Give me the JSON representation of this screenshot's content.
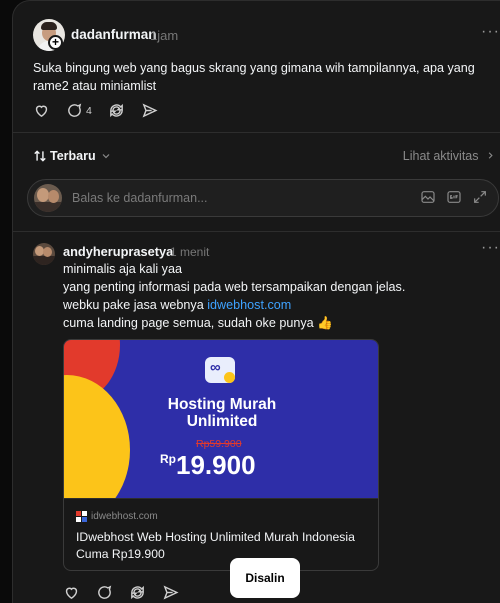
{
  "original_post": {
    "username": "dadanfurman",
    "time": "1jam",
    "more_label": "···",
    "plus_label": "+",
    "text": "Suka bingung web yang bagus skrang yang gimana wih tampilannya, apa yang rame2 atau miniamlist",
    "reply_count": "4"
  },
  "sort": {
    "label": "Terbaru",
    "activity_label": "Lihat aktivitas"
  },
  "reply_box": {
    "placeholder": "Balas ke dadanfurman..."
  },
  "reply": {
    "username": "andyheruprasetya",
    "time": "1 menit",
    "more_label": "···",
    "lines": [
      "minimalis aja kali yaa",
      "yang penting informasi pada web tersampaikan dengan jelas.",
      "webku pake jasa webnya ",
      "cuma landing page semua, sudah oke punya 👍"
    ],
    "link_text": "idwebhost.com"
  },
  "link_card": {
    "banner_title_1": "Hosting Murah",
    "banner_title_2": "Unlimited",
    "logo_glyph": "∞",
    "old_price": "Rp59.900",
    "currency": "Rp",
    "price": "19.900",
    "domain": "idwebhost.com",
    "title": "IDwebhost Web Hosting Unlimited Murah Indonesia Cuma Rp19.900",
    "colors": {
      "banner": "#2e2ea8",
      "red": "#e23a2c",
      "yellow": "#fcc419"
    }
  },
  "toast": {
    "label": "Disalin"
  },
  "icons": [
    "heart-icon",
    "comment-icon",
    "repost-icon",
    "share-icon",
    "sort-icon",
    "chevron-down-icon",
    "chevron-right-icon",
    "image-icon",
    "gif-icon",
    "expand-icon"
  ]
}
